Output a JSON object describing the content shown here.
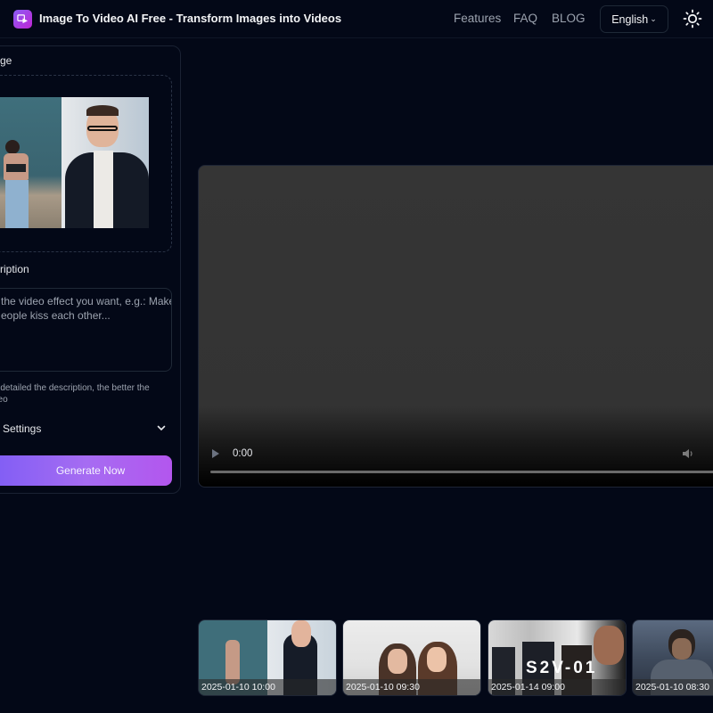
{
  "header": {
    "title": "Image To Video AI Free - Transform Images into Videos",
    "logo_icon": "video-play-icon",
    "nav": [
      "Features",
      "FAQ",
      "BLOG"
    ],
    "language": "English",
    "theme_icon": "sun-icon"
  },
  "form": {
    "image_label": "Image",
    "image_label_visible": "ge",
    "description_label_visible": "ription",
    "description_placeholder_lines": [
      "the video effect you want, e.g.: Make",
      "eople kiss each other..."
    ],
    "hint_lines": [
      "e detailed the description, the better the",
      "deo"
    ],
    "settings_label": "Settings",
    "generate_button": "Generate Now"
  },
  "player": {
    "current_time": "0:00",
    "progress": 0
  },
  "history": [
    {
      "timestamp": "2025-01-10 10:00",
      "overlay_text": ""
    },
    {
      "timestamp": "2025-01-10 09:30",
      "overlay_text": ""
    },
    {
      "timestamp": "2025-01-14 09:00",
      "overlay_text": "S2V-01"
    },
    {
      "timestamp": "2025-01-10 08:30",
      "overlay_text": ""
    }
  ],
  "colors": {
    "background": "#030817",
    "accent_start": "#7c5cf5",
    "accent_end": "#b356ee"
  }
}
